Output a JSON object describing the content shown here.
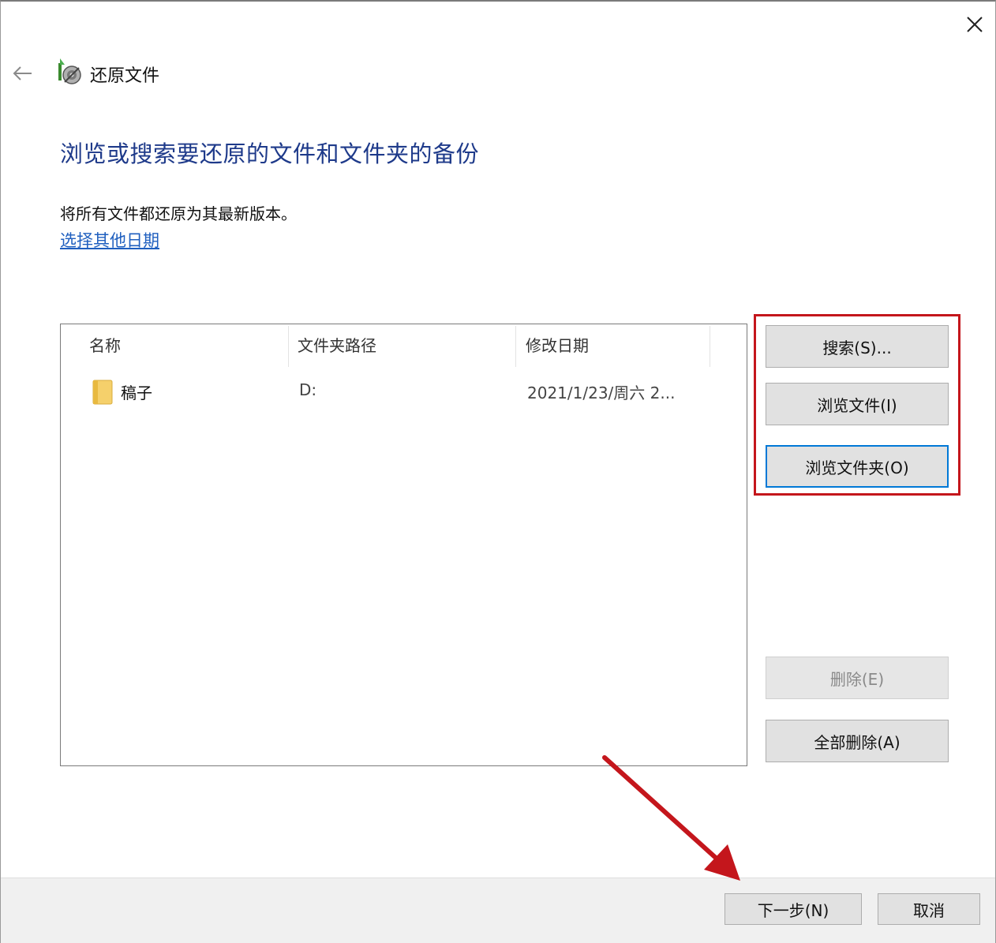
{
  "window": {
    "title": "还原文件",
    "close_icon": "close-icon",
    "back_icon": "back-arrow-icon"
  },
  "main": {
    "heading": "浏览或搜索要还原的文件和文件夹的备份",
    "description": "将所有文件都还原为其最新版本。",
    "choose_date_link": "选择其他日期"
  },
  "file_list": {
    "columns": [
      "名称",
      "文件夹路径",
      "修改日期"
    ],
    "rows": [
      {
        "icon": "folder-icon",
        "name": "稿子",
        "path": "D:",
        "modified": "2021/1/23/周六 2..."
      }
    ]
  },
  "side_buttons": {
    "search": "搜索(S)...",
    "browse_files": "浏览文件(I)",
    "browse_folders": "浏览文件夹(O)",
    "remove": "删除(E)",
    "remove_all": "全部删除(A)"
  },
  "footer": {
    "next": "下一步(N)",
    "cancel": "取消"
  },
  "colors": {
    "heading": "#1e3a8a",
    "link": "#1f5fbf",
    "annotation": "#c4161c",
    "focus": "#0078d7"
  }
}
